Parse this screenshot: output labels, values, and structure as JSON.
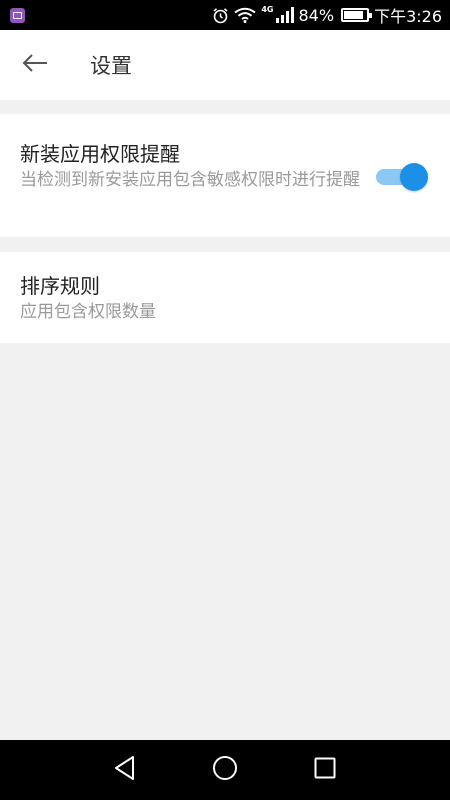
{
  "status_bar": {
    "network_type": "4G",
    "battery_percent": "84%",
    "battery_level": 0.84,
    "time": "下午3:26",
    "icons": [
      "gallery-icon",
      "alarm-icon",
      "wifi-icon",
      "signal-icon",
      "battery-icon"
    ]
  },
  "header": {
    "back_icon": "arrow-left-icon",
    "title": "设置"
  },
  "settings": [
    {
      "title": "新装应用权限提醒",
      "description": "当检测到新安装应用包含敏感权限时进行提醒",
      "toggle_on": true
    },
    {
      "title": "排序规则",
      "description": "应用包含权限数量"
    }
  ],
  "colors": {
    "accent": "#1c90e8",
    "accent_track": "#8cc8f3",
    "background": "#f1f1f1"
  },
  "nav_bar": {
    "icons": [
      "back-triangle-icon",
      "home-circle-icon",
      "recents-square-icon"
    ]
  }
}
